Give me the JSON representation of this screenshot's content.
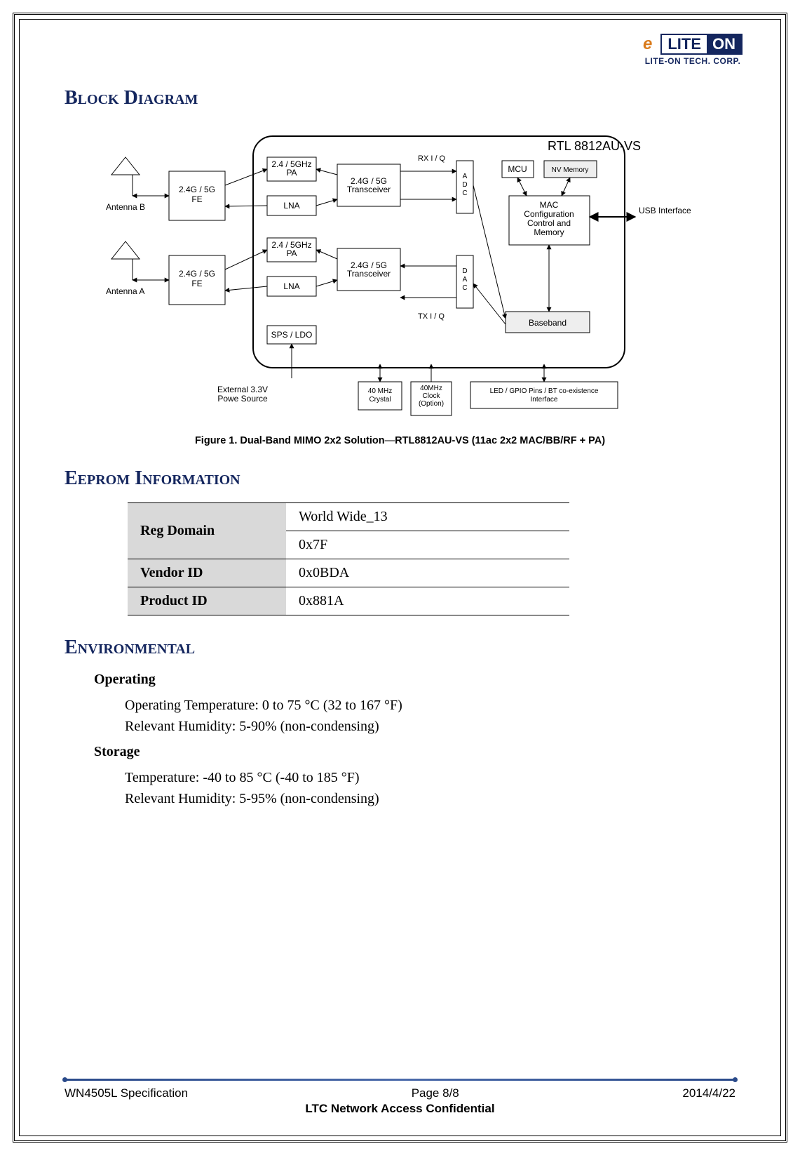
{
  "logo": {
    "text_left": "LITE",
    "text_right": "ON",
    "sub": "LITE-ON TECH. CORP."
  },
  "section_block_diagram": "Block Diagram",
  "diagram": {
    "chip": "RTL 8812AU-VS",
    "antenna_b": "Antenna B",
    "antenna_a": "Antenna A",
    "fe": "2.4G / 5G\nFE",
    "pa": "2.4 / 5GHz\nPA",
    "lna": "LNA",
    "transceiver": "2.4G / 5G\nTransceiver",
    "sps_ldo": "SPS / LDO",
    "rx_iq": "RX I / Q",
    "tx_iq": "TX I / Q",
    "adc": "A D C",
    "dac": "D A C",
    "mcu": "MCU",
    "nv": "NV Memory",
    "mac": "MAC\nConfiguration\nControl and\nMemory",
    "baseband": "Baseband",
    "usb": "USB Interface",
    "ext_power": "External 3.3V\nPowe Source",
    "crystal": "40  MHz\nCrystal",
    "clock": "40MHz\nClock\n(Option)",
    "led": "LED / GPIO Pins / BT co-existence\nInterface"
  },
  "figure_caption_a": "Figure 1.    Dual-Band MIMO 2x2 Solution",
  "figure_caption_b": "RTL8812AU-VS (11ac 2x2 MAC/BB/RF + PA)",
  "section_eeprom": "Eeprom Information",
  "eeprom": {
    "reg_domain": "Reg Domain",
    "reg_domain_val1": "World Wide_13",
    "reg_domain_val2": "0x7F",
    "vendor_id": "Vendor ID",
    "vendor_id_val": "0x0BDA",
    "product_id": "Product ID",
    "product_id_val": "0x881A"
  },
  "section_env": "Environmental",
  "env": {
    "operating_h": "Operating",
    "operating_temp": "Operating Temperature:  0 to 75 °C (32 to 167 °F)",
    "operating_hum": "Relevant Humidity:  5-90% (non-condensing)",
    "storage_h": "Storage",
    "storage_temp": "Temperature:  -40 to 85 °C (-40 to 185 °F)",
    "storage_hum": "Relevant Humidity:  5-95% (non-condensing)"
  },
  "footer": {
    "doc": "WN4505L Specification",
    "page": "Page 8/8",
    "date": "2014/4/22",
    "confidential": "LTC Network Access Confidential"
  }
}
